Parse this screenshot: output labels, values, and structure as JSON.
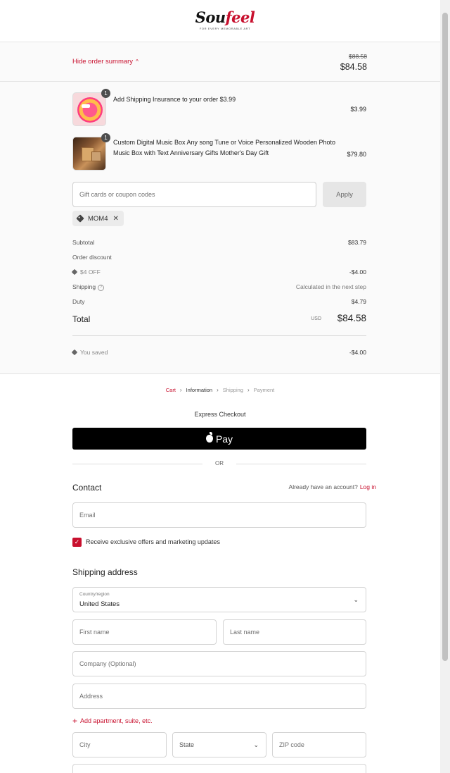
{
  "header": {
    "logo_text_main": "Sou",
    "logo_text_accent": "feel",
    "logo_tagline": "FOR EVERY MEMORABLE ART"
  },
  "summary": {
    "toggle_label": "Hide order summary",
    "original_price": "$88.58",
    "total_price": "$84.58",
    "items": [
      {
        "name": "Add Shipping Insurance to your order $3.99",
        "quantity": "1",
        "price": "$3.99",
        "thumb": "insurance-badge-image"
      },
      {
        "name": "Custom Digital Music Box Any song Tune or Voice Personalized Wooden Photo Music Box with Text Anniversary Gifts Mother's Day Gift",
        "quantity": "1",
        "price": "$79.80",
        "thumb": "wooden-music-box-image"
      }
    ],
    "coupon": {
      "placeholder": "Gift cards or coupon codes",
      "apply_label": "Apply",
      "applied_code": "MOM4"
    },
    "lines": {
      "subtotal_label": "Subtotal",
      "subtotal_value": "$83.79",
      "order_discount_label": "Order discount",
      "discount_code_label": "$4 OFF",
      "discount_value": "-$4.00",
      "shipping_label": "Shipping",
      "shipping_value": "Calculated in the next step",
      "duty_label": "Duty",
      "duty_value": "$4.79",
      "total_label": "Total",
      "currency": "USD",
      "total_value": "$84.58",
      "saved_label": "You saved",
      "saved_value": "-$4.00"
    }
  },
  "breadcrumb": {
    "cart": "Cart",
    "information": "Information",
    "shipping": "Shipping",
    "payment": "Payment"
  },
  "express": {
    "title": "Express Checkout",
    "apple_pay_label": "Pay",
    "or_label": "OR"
  },
  "contact": {
    "heading": "Contact",
    "account_prompt": "Already have an account?",
    "login_label": "Log in",
    "email_placeholder": "Email",
    "marketing_label": "Receive exclusive offers and marketing updates",
    "marketing_checked": true
  },
  "shipping_address": {
    "heading": "Shipping address",
    "country_label": "Country/region",
    "country_value": "United States",
    "first_name_placeholder": "First name",
    "last_name_placeholder": "Last name",
    "company_placeholder": "Company (Optional)",
    "address_placeholder": "Address",
    "add_apartment_label": "Add apartment, suite, etc.",
    "city_placeholder": "City",
    "state_label": "State",
    "zip_placeholder": "ZIP code"
  },
  "colors": {
    "accent": "#c8102e",
    "summary_bg": "#fafafa",
    "apple_pay_bg": "#000000"
  }
}
